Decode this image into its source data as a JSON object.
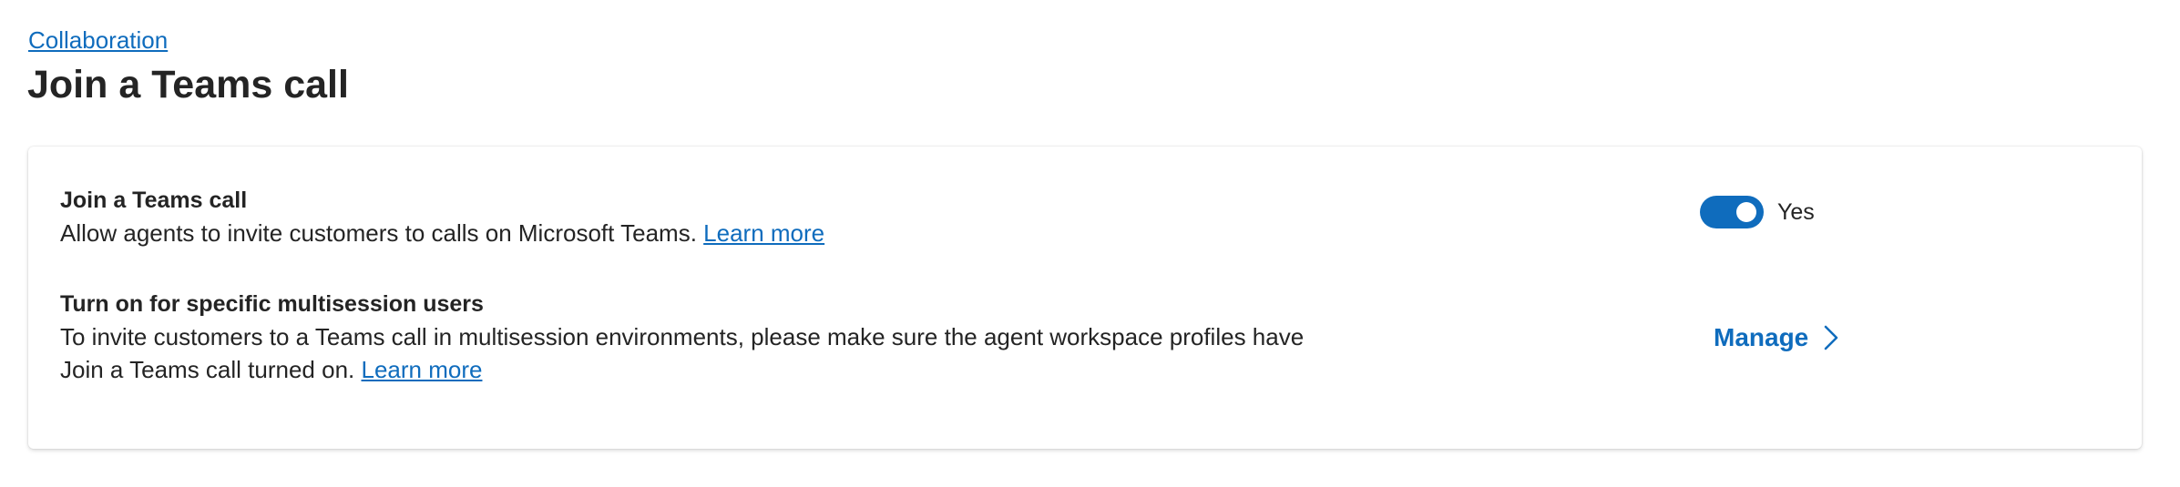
{
  "breadcrumb": {
    "label": "Collaboration"
  },
  "page": {
    "title": "Join a Teams call"
  },
  "settings": {
    "join_call": {
      "title": "Join a Teams call",
      "description": "Allow agents to invite customers to calls on Microsoft Teams.",
      "link": "Learn more",
      "toggle_on": true,
      "toggle_label": "Yes"
    },
    "multisession": {
      "title": "Turn on for specific multisession users",
      "description": "To invite customers to a Teams call in multisession environments, please make sure the agent workspace profiles have Join a Teams call turned on.",
      "link": "Learn more",
      "manage_label": "Manage",
      "manage_icon": "chevron-right-icon"
    }
  },
  "colors": {
    "accent": "#0f6cbd",
    "text": "#242424",
    "background": "#ffffff"
  }
}
